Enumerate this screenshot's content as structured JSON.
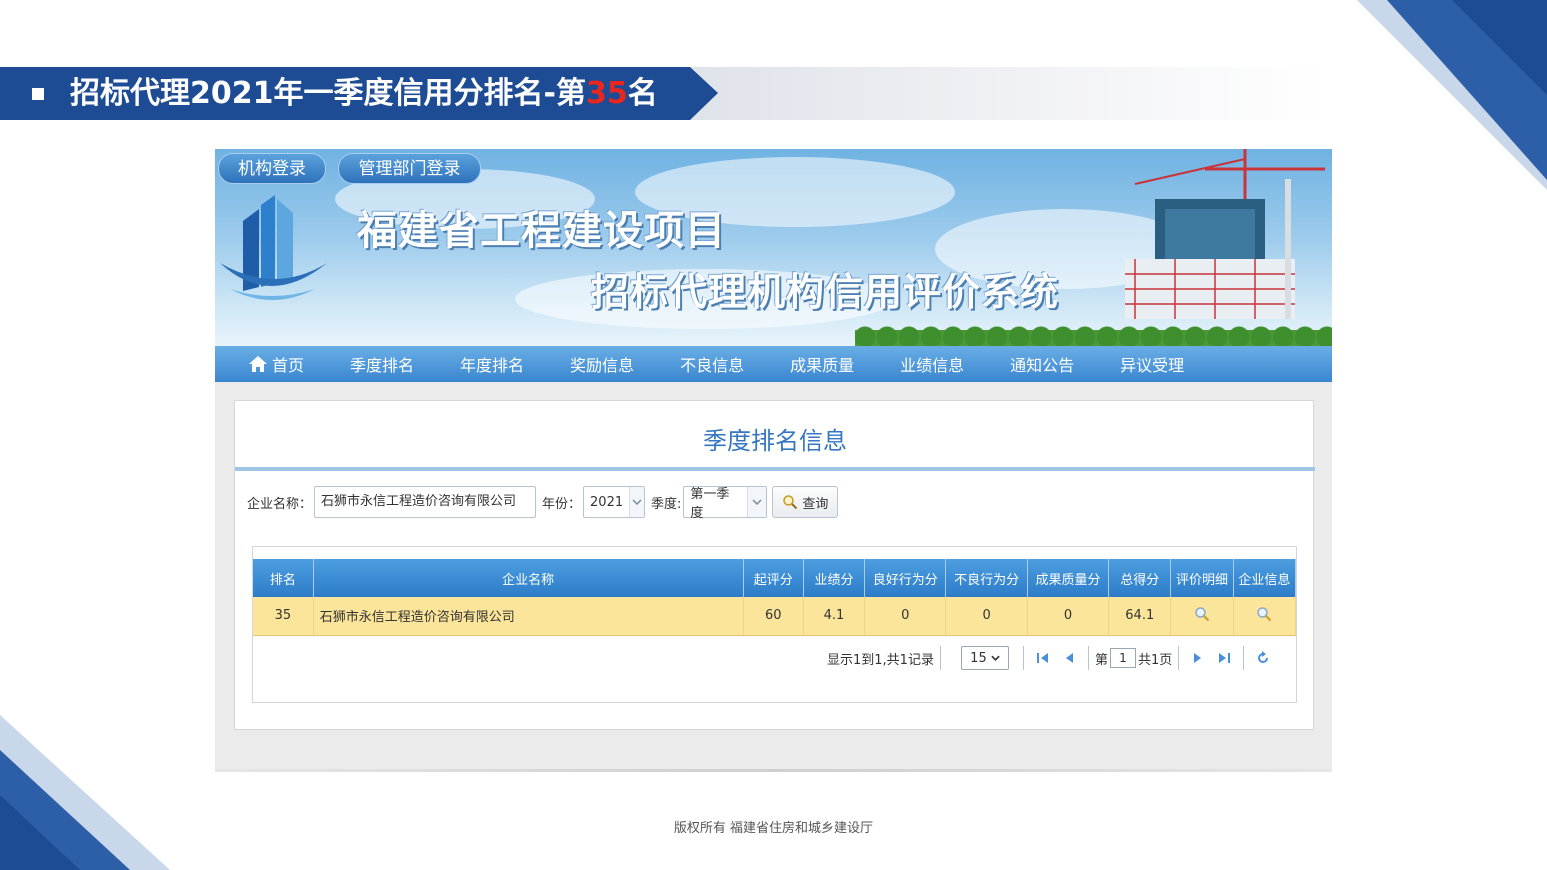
{
  "slide": {
    "title_prefix": "招标代理2021年一季度信用分排名-第",
    "title_rank": "35",
    "title_suffix": "名",
    "accent_color": "#1e4c94",
    "rank_color": "#e8281e"
  },
  "site": {
    "login_buttons": [
      "机构登录",
      "管理部门登录"
    ],
    "banner_line1": "福建省工程建设项目",
    "banner_line2": "招标代理机构信用评价系统",
    "nav": [
      {
        "label": "首页",
        "icon": "home-icon"
      },
      {
        "label": "季度排名"
      },
      {
        "label": "年度排名"
      },
      {
        "label": "奖励信息"
      },
      {
        "label": "不良信息"
      },
      {
        "label": "成果质量"
      },
      {
        "label": "业绩信息"
      },
      {
        "label": "通知公告"
      },
      {
        "label": "异议受理"
      }
    ]
  },
  "panel": {
    "title": "季度排名信息",
    "search": {
      "company_label": "企业名称：",
      "company_value": "石狮市永信工程造价咨询有限公司",
      "year_label": "年份：",
      "year_value": "2021",
      "quarter_label": "季度:",
      "quarter_value": "第一季度",
      "query_label": "查询"
    },
    "table": {
      "headers": [
        "排名",
        "企业名称",
        "起评分",
        "业绩分",
        "良好行为分",
        "不良行为分",
        "成果质量分",
        "总得分",
        "评价明细",
        "企业信息"
      ],
      "rows": [
        {
          "rank": "35",
          "name": "石狮市永信工程造价咨询有限公司",
          "base": "60",
          "perf": "4.1",
          "good": "0",
          "bad": "0",
          "quality": "0",
          "total": "64.1"
        }
      ]
    },
    "pager": {
      "summary": "显示1到1,共1记录",
      "page_size": "15",
      "page_prefix": "第",
      "page_value": "1",
      "page_suffix": "共1页"
    }
  },
  "footer": {
    "text": "版权所有  福建省住房和城乡建设厅"
  }
}
